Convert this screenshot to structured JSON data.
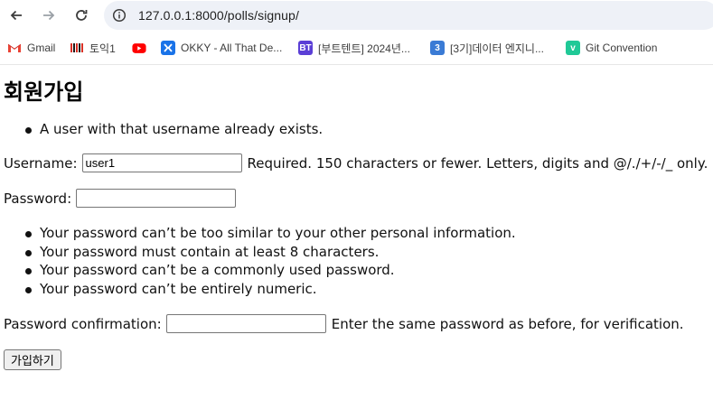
{
  "browser": {
    "url": "127.0.0.1:8000/polls/signup/",
    "bookmarks": [
      {
        "label": "Gmail",
        "icon": "gmail-icon"
      },
      {
        "label": "토익1",
        "icon": "toeic-icon"
      },
      {
        "label": "",
        "icon": "youtube-icon"
      },
      {
        "label": "OKKY - All That De...",
        "icon": "okky-icon"
      },
      {
        "label": "[부트텐트] 2024년...",
        "icon": "bt-icon"
      },
      {
        "label": "[3기]데이터 엔지니...",
        "icon": "number3-icon"
      },
      {
        "label": "Git Convention",
        "icon": "velog-icon"
      }
    ],
    "bookmark_icon_text": {
      "bt": "BT",
      "three": "3",
      "velog": "v"
    }
  },
  "page": {
    "title": "회원가입",
    "errors": [
      "A user with that username already exists."
    ],
    "username": {
      "label": "Username:",
      "value": "user1",
      "help": "Required. 150 characters or fewer. Letters, digits and @/./+/-/_ only."
    },
    "password": {
      "label": "Password:",
      "value": "",
      "help": [
        "Your password can’t be too similar to your other personal information.",
        "Your password must contain at least 8 characters.",
        "Your password can’t be a commonly used password.",
        "Your password can’t be entirely numeric."
      ]
    },
    "password_confirm": {
      "label": "Password confirmation:",
      "value": "",
      "help": "Enter the same password as before, for verification."
    },
    "submit_label": "가입하기"
  },
  "colors": {
    "omnibox_bg": "#eef1f7",
    "youtube_red": "#ff0000",
    "okky_blue": "#1a73e8",
    "bt_purple": "#5b3fd6",
    "three_blue": "#3a7bd5",
    "velog_green": "#20c997"
  }
}
